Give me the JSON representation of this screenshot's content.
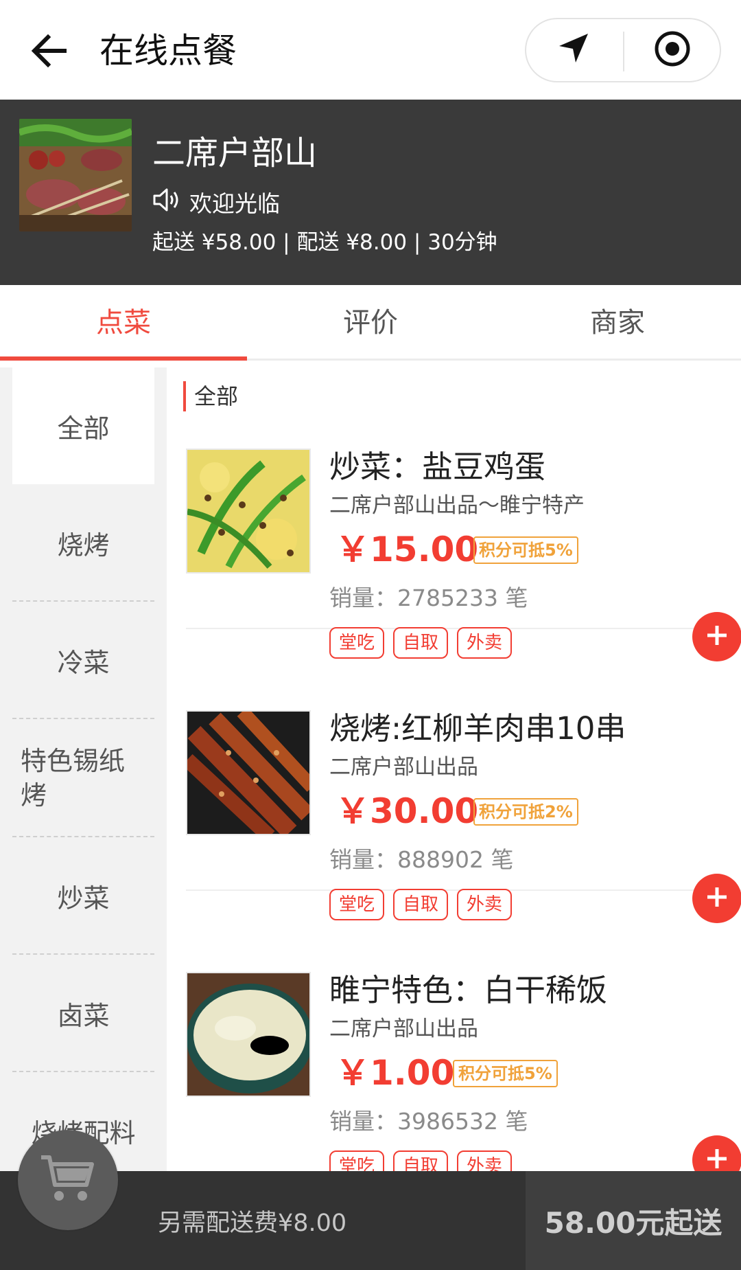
{
  "header": {
    "title": "在线点餐",
    "back_icon": "back-arrow-icon",
    "location_icon": "navigation-icon",
    "target_icon": "record-icon"
  },
  "shop": {
    "name": "二席户部山",
    "notice": "欢迎光临",
    "meta": "起送 ¥58.00 | 配送 ¥8.00 | 30分钟"
  },
  "tabs": [
    {
      "label": "点菜"
    },
    {
      "label": "评价"
    },
    {
      "label": "商家"
    }
  ],
  "categories": [
    {
      "label": "全部"
    },
    {
      "label": "烧烤"
    },
    {
      "label": "冷菜"
    },
    {
      "label": "特色锡纸烤"
    },
    {
      "label": "炒菜"
    },
    {
      "label": "卤菜"
    },
    {
      "label": "烧烤配料"
    }
  ],
  "list": {
    "section_title": "全部",
    "products": [
      {
        "name": "炒菜：盐豆鸡蛋",
        "sub": "二席户部山出品～睢宁特产",
        "price": "￥15.00",
        "badge": "积分可抵5%",
        "sales": "销量：2785233 笔",
        "tags": [
          "堂吃",
          "自取",
          "外卖"
        ]
      },
      {
        "name": "烧烤:红柳羊肉串10串",
        "sub": "二席户部山出品",
        "price": "￥30.00",
        "badge": "积分可抵2%",
        "sales": "销量：888902 笔",
        "tags": [
          "堂吃",
          "自取",
          "外卖"
        ]
      },
      {
        "name": "睢宁特色：白干稀饭",
        "sub": "二席户部山出品",
        "price": "￥1.00",
        "badge": "积分可抵5%",
        "sales": "销量：3986532 笔",
        "tags": [
          "堂吃",
          "自取",
          "外卖"
        ]
      }
    ]
  },
  "footer": {
    "delivery_fee": "另需配送费¥8.00",
    "min_order": "58.00元起送",
    "cart_icon": "cart-icon"
  },
  "colors": {
    "accent": "#f04a3e",
    "price": "#f23d32",
    "badge": "#f0a23a",
    "dark_bg": "#3a3a3a"
  }
}
